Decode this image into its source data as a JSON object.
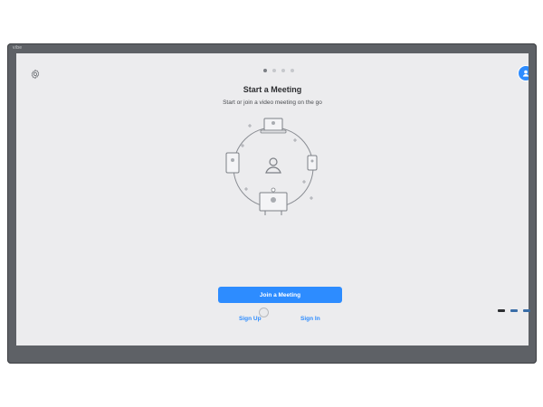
{
  "device": {
    "brand": "vibe"
  },
  "onboarding": {
    "title": "Start a Meeting",
    "subtitle": "Start or join a video meeting on the go",
    "page_indicator": {
      "total": 4,
      "active": 1
    }
  },
  "actions": {
    "join_label": "Join a Meeting",
    "sign_up_label": "Sign Up",
    "sign_in_label": "Sign In"
  },
  "icons": {
    "settings": "gear-icon",
    "profile": "user-badge-icon",
    "illustration": "devices-network-illustration",
    "power": "power-button-icon"
  },
  "colors": {
    "accent": "#2d8cff",
    "screen_bg": "#ececee",
    "bezel": "#5e6166",
    "text_dark": "#2c2d30"
  }
}
